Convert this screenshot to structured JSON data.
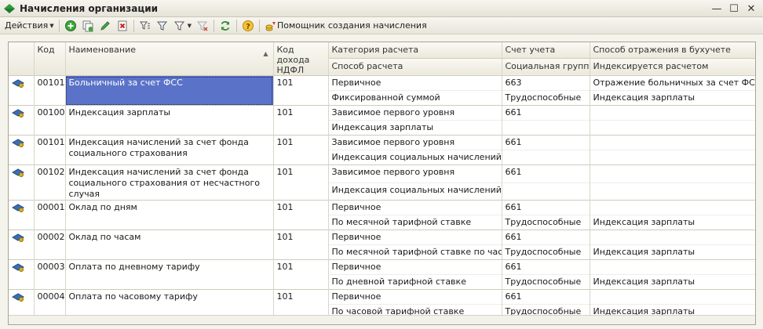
{
  "window": {
    "title": "Начисления организации",
    "buttons": [
      "—",
      "☐",
      "✕"
    ]
  },
  "toolbar": {
    "actions_label": "Действия",
    "wizard_label": "Помощник создания начисления"
  },
  "columns": {
    "code": "Код",
    "name": "Наименование",
    "income_code": "Код дохода НДФЛ",
    "calc_category": "Категория расчета",
    "account": "Счет учета",
    "reflection": "Способ отражения в бухучете",
    "calc_method": "Способ расчета",
    "social_group": "Социальная группа",
    "indexed_by": "Индексируется расчетом"
  },
  "rows": [
    {
      "code": "00101",
      "name": "Больничный за счет ФСС",
      "income_code": "101",
      "calc_category": "Первичное",
      "account": "663",
      "reflection": "Отражение больничных за счет ФСС",
      "calc_method": "Фиксированной суммой",
      "social_group": "Трудоспособные",
      "indexed_by": "Индексация зарплаты",
      "selected": true
    },
    {
      "code": "00100",
      "name": "Индексация зарплаты",
      "income_code": "101",
      "calc_category": "Зависимое первого уровня",
      "account": "661",
      "reflection": "",
      "calc_method": "Индексация зарплаты",
      "social_group": "",
      "indexed_by": ""
    },
    {
      "code": "00101",
      "name": "Индексация начислений за счет фонда социального страхования",
      "income_code": "101",
      "calc_category": "Зависимое первого уровня",
      "account": "661",
      "reflection": "",
      "calc_method": "Индексация социальных начислений",
      "social_group": "",
      "indexed_by": ""
    },
    {
      "code": "00102",
      "name": "Индексация начислений за счет фонда социального страхования от несчастного случая",
      "income_code": "101",
      "calc_category": "Зависимое первого уровня",
      "account": "661",
      "reflection": "",
      "calc_method": "Индексация социальных начислений",
      "social_group": "",
      "indexed_by": ""
    },
    {
      "code": "00001",
      "name": "Оклад по дням",
      "income_code": "101",
      "calc_category": "Первичное",
      "account": "661",
      "reflection": "",
      "calc_method": "По месячной тарифной ставке",
      "social_group": "Трудоспособные",
      "indexed_by": "Индексация зарплаты"
    },
    {
      "code": "00002",
      "name": "Оклад по часам",
      "income_code": "101",
      "calc_category": "Первичное",
      "account": "661",
      "reflection": "",
      "calc_method": "По месячной тарифной ставке по часам",
      "social_group": "Трудоспособные",
      "indexed_by": "Индексация зарплаты"
    },
    {
      "code": "00003",
      "name": "Оплата по дневному тарифу",
      "income_code": "101",
      "calc_category": "Первичное",
      "account": "661",
      "reflection": "",
      "calc_method": "По дневной тарифной ставке",
      "social_group": "Трудоспособные",
      "indexed_by": "Индексация зарплаты"
    },
    {
      "code": "00004",
      "name": "Оплата по часовому тарифу",
      "income_code": "101",
      "calc_category": "Первичное",
      "account": "661",
      "reflection": "",
      "calc_method": "По часовой тарифной ставке",
      "social_group": "Трудоспособные",
      "indexed_by": "Индексация зарплаты"
    }
  ]
}
